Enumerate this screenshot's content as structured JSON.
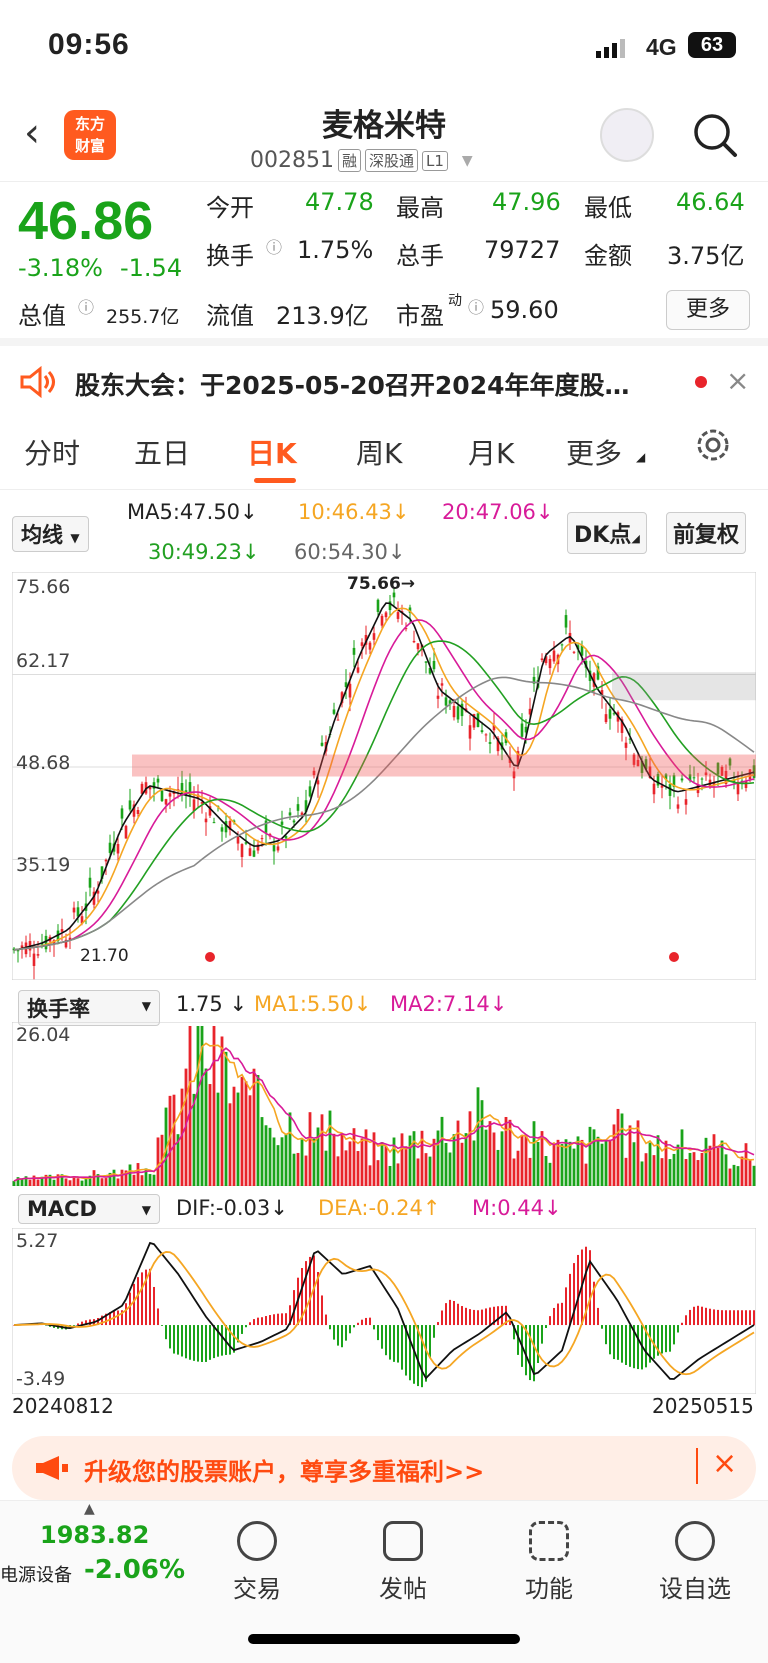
{
  "status": {
    "time": "09:56",
    "network": "4G",
    "battery": "63"
  },
  "header": {
    "title": "麦格米特",
    "code": "002851",
    "tags": [
      "融",
      "深股通",
      "L1"
    ],
    "logo_line1": "东方",
    "logo_line2": "财富"
  },
  "quote": {
    "price": "46.86",
    "pct": "-3.18%",
    "change": "-1.54",
    "open_label": "今开",
    "open": "47.78",
    "high_label": "最高",
    "high": "47.96",
    "low_label": "最低",
    "low": "46.64",
    "turnover_label": "换手",
    "turnover": "1.75%",
    "volume_label": "总手",
    "volume": "79727",
    "amount_label": "金额",
    "amount": "3.75亿",
    "mcap_label": "总值",
    "mcap": "255.7亿",
    "float_label": "流值",
    "float": "213.9亿",
    "pe_label": "市盈",
    "pe_sup": "动",
    "pe": "59.60",
    "more": "更多"
  },
  "notice": {
    "text": "股东大会：于2025-05-20召开2024年年度股…"
  },
  "tabs": [
    "分时",
    "五日",
    "日K",
    "周K",
    "月K",
    "更多"
  ],
  "kline": {
    "selector": "均线",
    "dk": "DK点",
    "adj": "前复权",
    "ma5": "MA5:47.50",
    "ma10": "10:46.43",
    "ma20": "20:47.06",
    "ma30": "30:49.23",
    "ma60": "60:54.30",
    "y_labels": [
      "75.66",
      "62.17",
      "48.68",
      "35.19",
      "21.70"
    ],
    "peak_label": "75.66",
    "low_label": "21.70"
  },
  "turnover_chart": {
    "selector": "换手率",
    "val": "1.75",
    "ma1": "MA1:5.50",
    "ma2": "MA2:7.14",
    "top": "26.04"
  },
  "macd": {
    "selector": "MACD",
    "dif": "DIF:-0.03",
    "dea": "DEA:-0.24",
    "m": "M:0.44",
    "top": "5.27",
    "bottom": "-3.49",
    "date_start": "20240812",
    "date_end": "20250515"
  },
  "promo": {
    "text": "升级您的股票账户，尊享多重福利>>"
  },
  "bottom_nav": {
    "index_value": "1983.82",
    "index_name": "电源设备",
    "index_pct": "-2.06%",
    "items": [
      "交易",
      "发帖",
      "功能",
      "设自选"
    ]
  },
  "colors": {
    "up": "#e8242b",
    "down": "#1aa31a",
    "accent": "#ff5a1f",
    "ma5": "#111111",
    "ma10": "#f5a623",
    "ma20": "#d81b99",
    "ma30": "#22a022",
    "ma60": "#888888"
  },
  "chart_data": {
    "type": "candlestick",
    "x_start": "20240812",
    "x_end": "20250515",
    "ylim": [
      21.7,
      75.66
    ],
    "ma5_approx": [
      22,
      23,
      25,
      30,
      40,
      46,
      45,
      44,
      40,
      37,
      38,
      42,
      55,
      65,
      73,
      70,
      60,
      57,
      54,
      48,
      65,
      68,
      60,
      55,
      47,
      45,
      46,
      47,
      48
    ],
    "turnover_ylim": [
      0,
      26.04
    ],
    "macd_ylim": [
      -3.49,
      5.27
    ]
  }
}
